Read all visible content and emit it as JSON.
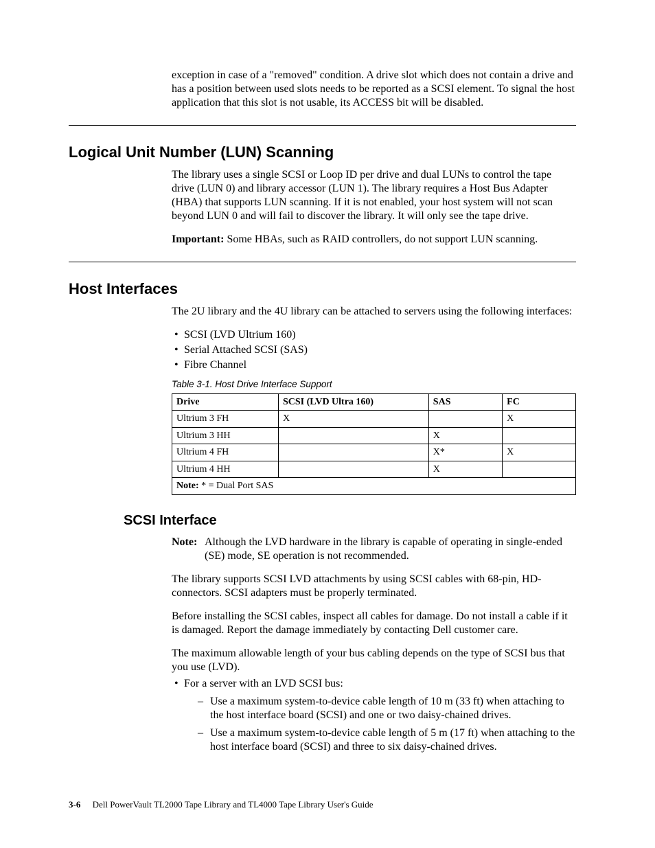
{
  "intro": {
    "para1": "exception in case of a \"removed\" condition. A drive slot which does not contain a drive and has a position between used slots needs to be reported as a SCSI element. To signal the host application that this slot is not usable, its ACCESS bit will be disabled."
  },
  "lun": {
    "heading": "Logical Unit Number (LUN) Scanning",
    "para1": "The library uses a single SCSI or Loop ID per drive and dual LUNs to control the tape drive (LUN 0) and library accessor (LUN 1). The library requires a Host Bus Adapter (HBA) that supports LUN scanning. If it is not enabled, your host system will not scan beyond LUN 0 and will fail to discover the library. It will only see the tape drive.",
    "important_label": "Important:",
    "important_text": " Some HBAs, such as RAID controllers, do not support LUN scanning."
  },
  "host": {
    "heading": "Host Interfaces",
    "para1": "The 2U library and the 4U library can be attached to servers using the following interfaces:",
    "bullets": [
      "SCSI (LVD Ultrium 160)",
      "Serial Attached SCSI (SAS)",
      "Fibre Channel"
    ],
    "table_caption": "Table 3-1. Host Drive Interface Support",
    "table": {
      "headers": [
        "Drive",
        "SCSI (LVD Ultra 160)",
        "SAS",
        "FC"
      ],
      "rows": [
        {
          "drive": "Ultrium 3 FH",
          "scsi": "X",
          "sas": "",
          "fc": "X"
        },
        {
          "drive": "Ultrium 3 HH",
          "scsi": "",
          "sas": "X",
          "fc": ""
        },
        {
          "drive": "Ultrium 4 FH",
          "scsi": "",
          "sas": "X*",
          "fc": "X"
        },
        {
          "drive": "Ultrium 4 HH",
          "scsi": "",
          "sas": "X",
          "fc": ""
        }
      ],
      "note_label": "Note:",
      "note_text": " * = Dual Port SAS"
    }
  },
  "scsi": {
    "heading": "SCSI Interface",
    "note_label": "Note:",
    "note_text": "Although the LVD hardware in the library is capable of operating in single-ended (SE) mode, SE operation is not recommended.",
    "para1": "The library supports SCSI LVD attachments by using SCSI cables with 68-pin, HD-connectors. SCSI adapters must be properly terminated.",
    "para2": "Before installing the SCSI cables, inspect all cables for damage. Do not install a cable if it is damaged. Report the damage immediately by contacting Dell customer care.",
    "para3": "The maximum allowable length of your bus cabling depends on the type of SCSI bus that you use (LVD).",
    "bullet": "For a server with an LVD SCSI bus:",
    "subbullets": [
      "Use a maximum system-to-device cable length of 10 m (33 ft) when attaching to the host interface board (SCSI) and one or two daisy-chained drives.",
      "Use a maximum system-to-device cable length of 5 m (17 ft) when attaching to the host interface board (SCSI) and three to six daisy-chained drives."
    ]
  },
  "footer": {
    "page": "3-6",
    "title": "Dell PowerVault TL2000 Tape Library and TL4000 Tape Library User's Guide"
  }
}
